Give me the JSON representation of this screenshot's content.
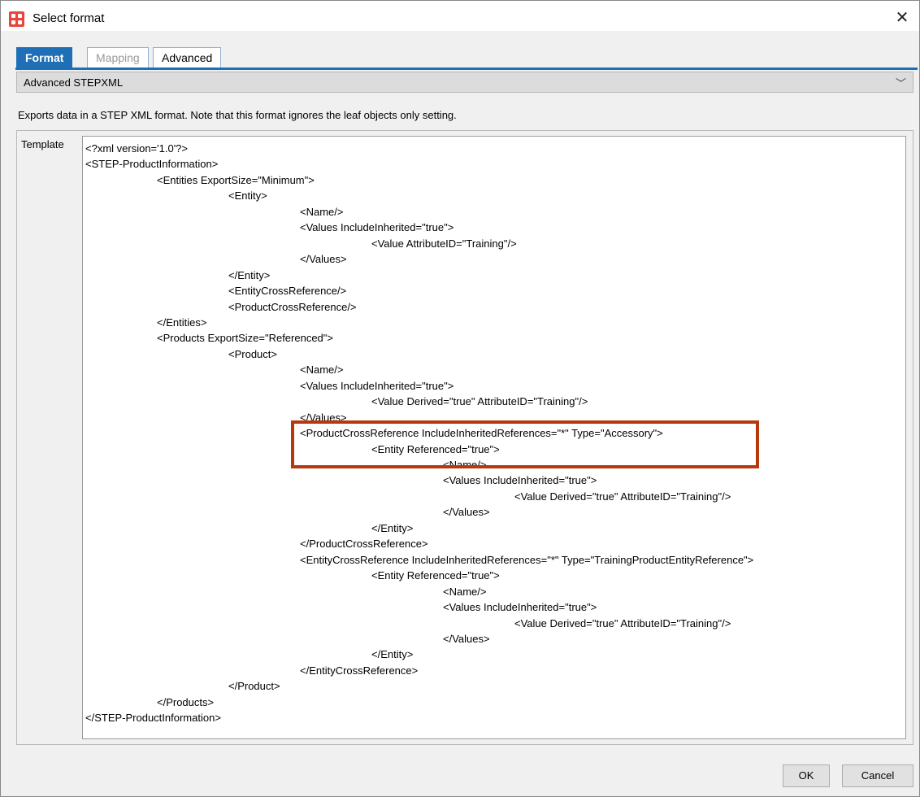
{
  "window": {
    "title": "Select format"
  },
  "tabs": [
    {
      "label": "Format",
      "state": "active"
    },
    {
      "label": "Mapping",
      "state": "disabled"
    },
    {
      "label": "Advanced",
      "state": "normal"
    }
  ],
  "format_select": {
    "value": "Advanced STEPXML"
  },
  "description": "Exports data in a STEP XML format. Note that this format ignores the leaf objects only setting.",
  "template": {
    "label": "Template",
    "lines": [
      {
        "indent": 0,
        "text": "<?xml version='1.0'?>"
      },
      {
        "indent": 0,
        "text": "<STEP-ProductInformation>"
      },
      {
        "indent": 1,
        "text": "<Entities ExportSize=\"Minimum\">"
      },
      {
        "indent": 2,
        "text": "<Entity>"
      },
      {
        "indent": 3,
        "text": "<Name/>"
      },
      {
        "indent": 3,
        "text": "<Values IncludeInherited=\"true\">"
      },
      {
        "indent": 4,
        "text": "<Value AttributeID=\"Training\"/>"
      },
      {
        "indent": 3,
        "text": "</Values>"
      },
      {
        "indent": 2,
        "text": "</Entity>"
      },
      {
        "indent": 2,
        "text": "<EntityCrossReference/>"
      },
      {
        "indent": 2,
        "text": "<ProductCrossReference/>"
      },
      {
        "indent": 1,
        "text": "</Entities>"
      },
      {
        "indent": 1,
        "text": "<Products ExportSize=\"Referenced\">"
      },
      {
        "indent": 2,
        "text": "<Product>"
      },
      {
        "indent": 3,
        "text": "<Name/>"
      },
      {
        "indent": 3,
        "text": "<Values IncludeInherited=\"true\">"
      },
      {
        "indent": 4,
        "text": "<Value Derived=\"true\" AttributeID=\"Training\"/>"
      },
      {
        "indent": 3,
        "text": "</Values>"
      },
      {
        "indent": 3,
        "text": "<ProductCrossReference IncludeInheritedReferences=\"*\" Type=\"Accessory\">"
      },
      {
        "indent": 4,
        "text": "<Entity Referenced=\"true\">"
      },
      {
        "indent": 5,
        "text": "<Name/>"
      },
      {
        "indent": 5,
        "text": "<Values IncludeInherited=\"true\">"
      },
      {
        "indent": 6,
        "text": "<Value Derived=\"true\" AttributeID=\"Training\"/>"
      },
      {
        "indent": 5,
        "text": "</Values>"
      },
      {
        "indent": 4,
        "text": "</Entity>"
      },
      {
        "indent": 3,
        "text": "</ProductCrossReference>"
      },
      {
        "indent": 3,
        "text": "<EntityCrossReference IncludeInheritedReferences=\"*\" Type=\"TrainingProductEntityReference\">"
      },
      {
        "indent": 4,
        "text": "<Entity Referenced=\"true\">"
      },
      {
        "indent": 5,
        "text": "<Name/>"
      },
      {
        "indent": 5,
        "text": "<Values IncludeInherited=\"true\">"
      },
      {
        "indent": 6,
        "text": "<Value Derived=\"true\" AttributeID=\"Training\"/>"
      },
      {
        "indent": 5,
        "text": "</Values>"
      },
      {
        "indent": 4,
        "text": "</Entity>"
      },
      {
        "indent": 3,
        "text": "</EntityCrossReference>"
      },
      {
        "indent": 2,
        "text": "</Product>"
      },
      {
        "indent": 1,
        "text": "</Products>"
      },
      {
        "indent": 0,
        "text": "</STEP-ProductInformation>"
      }
    ]
  },
  "buttons": {
    "ok": "OK",
    "cancel": "Cancel"
  },
  "colors": {
    "accent": "#1f6fb6",
    "highlight": "#b8370d",
    "app_icon": "#e8463a"
  }
}
